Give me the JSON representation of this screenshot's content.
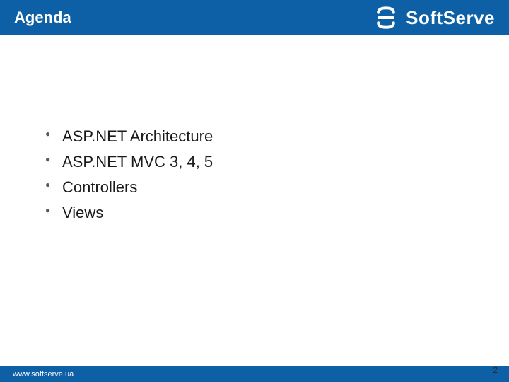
{
  "header": {
    "title": "Agenda",
    "brand": "SoftServe"
  },
  "agenda": {
    "items": [
      "ASP.NET Architecture",
      "ASP.NET MVC 3, 4, 5",
      "Controllers",
      "Views"
    ]
  },
  "footer": {
    "url": "www.softserve.ua",
    "page_number": "2"
  }
}
